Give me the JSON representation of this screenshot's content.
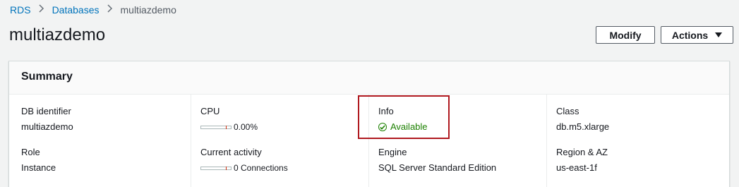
{
  "breadcrumb": {
    "items": [
      "RDS",
      "Databases"
    ],
    "current": "multiazdemo"
  },
  "page": {
    "title": "multiazdemo"
  },
  "actions": {
    "modify_label": "Modify",
    "actions_label": "Actions"
  },
  "summary": {
    "title": "Summary",
    "db_identifier": {
      "label": "DB identifier",
      "value": "multiazdemo"
    },
    "role": {
      "label": "Role",
      "value": "Instance"
    },
    "cpu": {
      "label": "CPU",
      "value": "0.00%"
    },
    "current_activity": {
      "label": "Current activity",
      "value": "0 Connections"
    },
    "info": {
      "label": "Info",
      "value": "Available",
      "status_color": "#1d8102"
    },
    "engine": {
      "label": "Engine",
      "value": "SQL Server Standard Edition"
    },
    "class": {
      "label": "Class",
      "value": "db.m5.xlarge"
    },
    "region": {
      "label": "Region & AZ",
      "value": "us-east-1f"
    }
  },
  "icons": {
    "breadcrumb_separator": "chevron-right-icon",
    "actions_caret": "caret-down-icon",
    "status": "check-circle-icon"
  },
  "colors": {
    "link": "#0073bb",
    "highlight": "#b0191f",
    "meter_marker": "#d13212"
  }
}
